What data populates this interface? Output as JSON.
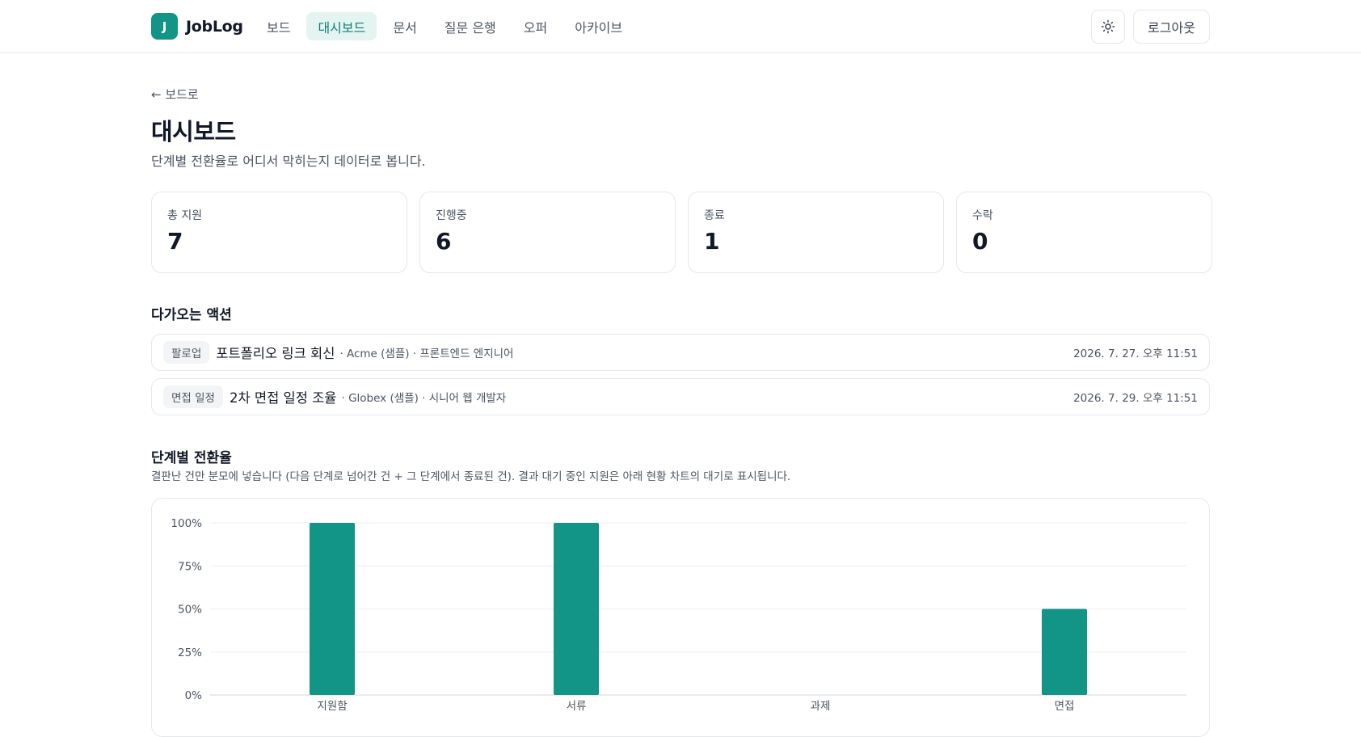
{
  "app": {
    "logo_letter": "J",
    "name": "JobLog"
  },
  "nav": {
    "items": [
      "보드",
      "대시보드",
      "문서",
      "질문 은행",
      "오퍼",
      "아카이브"
    ],
    "active": "대시보드"
  },
  "header": {
    "theme_icon": "sun-icon",
    "logout_label": "로그아웃"
  },
  "page": {
    "back_label": "← 보드로",
    "title": "대시보드",
    "subtitle": "단계별 전환율로 어디서 막히는지 데이터로 봅니다."
  },
  "stats": [
    {
      "label": "총 지원",
      "value": "7"
    },
    {
      "label": "진행중",
      "value": "6"
    },
    {
      "label": "종료",
      "value": "1"
    },
    {
      "label": "수락",
      "value": "0"
    }
  ],
  "actions": {
    "title": "다가오는 액션",
    "items": [
      {
        "tag": "팔로업",
        "title": "포트폴리오 링크 회신",
        "meta": "· Acme (샘플) · 프론트엔드 엔지니어",
        "date": "2026. 7. 27. 오후 11:51"
      },
      {
        "tag": "면접 일정",
        "title": "2차 면접 일정 조율",
        "meta": "· Globex (샘플) · 시니어 웹 개발자",
        "date": "2026. 7. 29. 오후 11:51"
      }
    ]
  },
  "conversion": {
    "title": "단계별 전환율",
    "description": "결판난 건만 분모에 넣습니다 (다음 단계로 넘어간 건 + 그 단계에서 종료된 건). 결과 대기 중인 지원은 아래 현황 차트의 대기로 표시됩니다."
  },
  "chart_data": {
    "type": "bar",
    "categories": [
      "지원함",
      "서류",
      "과제",
      "면접"
    ],
    "values": [
      100,
      100,
      0,
      50
    ],
    "ylim": [
      0,
      100
    ],
    "yticks": [
      "0%",
      "25%",
      "50%",
      "75%",
      "100%"
    ],
    "bar_color": "#129486",
    "grid": true
  }
}
